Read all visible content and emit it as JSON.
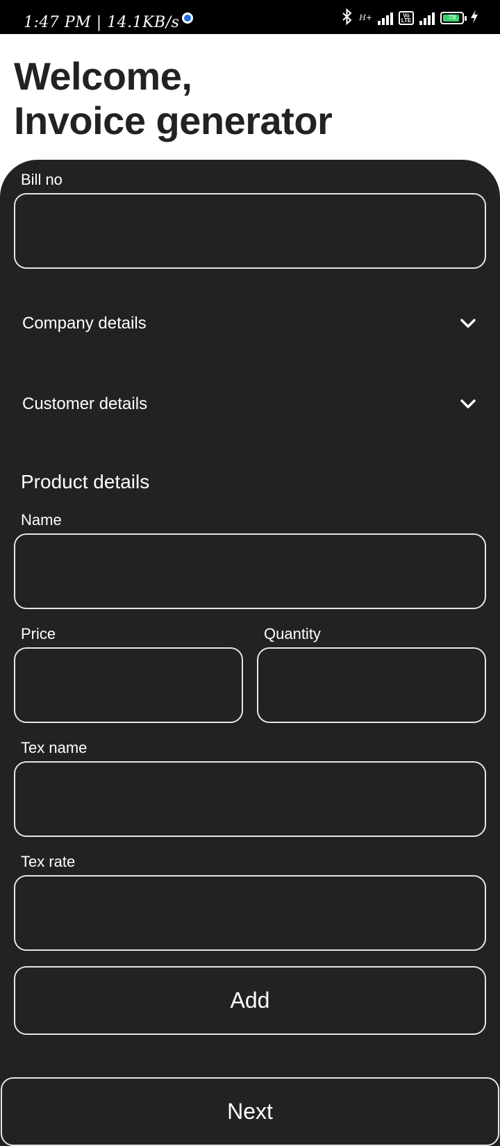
{
  "status_bar": {
    "time_speed": "1:47 PM | 14.1KB/s",
    "network_type": "H+",
    "volte_label": "Vo LTE",
    "battery_level": "78"
  },
  "header": {
    "line1": "Welcome,",
    "line2": "Invoice generator"
  },
  "form": {
    "bill_no_label": "Bill no",
    "bill_no_value": "",
    "company_details_label": "Company details",
    "customer_details_label": "Customer details",
    "product_section_title": "Product details",
    "name_label": "Name",
    "name_value": "",
    "price_label": "Price",
    "price_value": "",
    "quantity_label": "Quantity",
    "quantity_value": "",
    "tax_name_label": "Tex name",
    "tax_name_value": "",
    "tax_rate_label": "Tex rate",
    "tax_rate_value": ""
  },
  "actions": {
    "add_label": "Add",
    "next_label": "Next"
  },
  "icons": {
    "expander_icon": "chevron-down-icon",
    "bluetooth_icon": "bluetooth-icon",
    "charging_icon": "lightning-icon"
  },
  "colors": {
    "panel_background": "#222222",
    "page_background": "#ffffff",
    "header_text": "#222222",
    "field_border": "#e6e6e6",
    "battery_fill": "#3ad06e",
    "notification_dot": "#1e6fe0"
  }
}
